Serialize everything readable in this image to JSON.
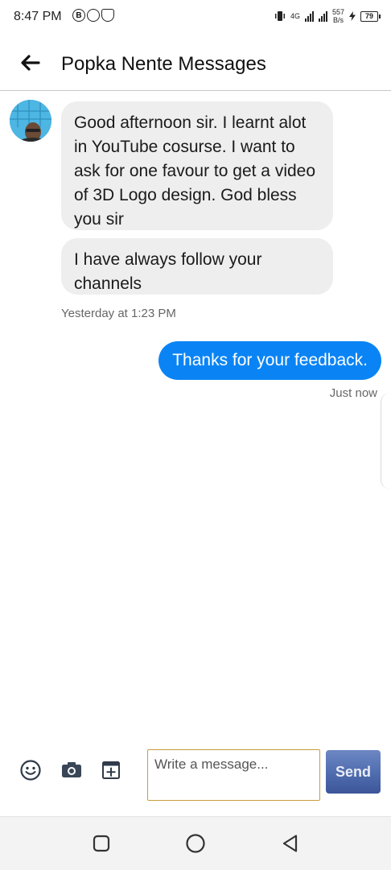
{
  "status_bar": {
    "time": "8:47 PM",
    "net_speed_value": "557",
    "net_speed_unit": "B/s",
    "network_label": "4G",
    "battery": "79"
  },
  "header": {
    "title": "Popka Nente Messages"
  },
  "messages": [
    {
      "direction": "incoming",
      "text": "Good afternoon sir.  I learnt alot in YouTube cosurse.  I want to ask for one favour to get a video of 3D Logo design.  God bless you sir"
    },
    {
      "direction": "incoming",
      "text": "I have always follow your channels"
    },
    {
      "direction": "outgoing",
      "text": "Thanks for your feedback."
    }
  ],
  "timestamps": {
    "incoming": "Yesterday at 1:23 PM",
    "outgoing": "Just now"
  },
  "composer": {
    "placeholder": "Write a message...",
    "send_label": "Send"
  },
  "colors": {
    "outgoing_bubble": "#0a84f5",
    "incoming_bubble": "#eeeeee",
    "send_button": "#4f6cae",
    "input_border": "#c89e3c"
  }
}
